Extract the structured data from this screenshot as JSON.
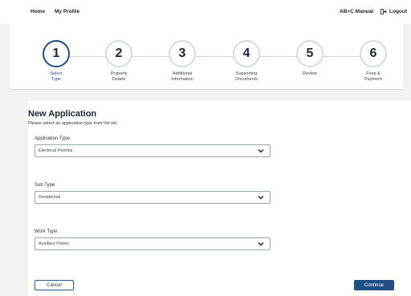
{
  "nav": {
    "home": "Home",
    "profile": "My Profile",
    "manual": "AB+C Manual",
    "logout": "Logout",
    "logout_icon": "logout-icon"
  },
  "steps": [
    {
      "number": "1",
      "line1": "Select",
      "line2": "Type",
      "active": true
    },
    {
      "number": "2",
      "line1": "Property",
      "line2": "Details",
      "active": false
    },
    {
      "number": "3",
      "line1": "Additional",
      "line2": "Information",
      "active": false
    },
    {
      "number": "4",
      "line1": "Supporting",
      "line2": "Documents",
      "active": false
    },
    {
      "number": "5",
      "line1": "Review",
      "line2": "",
      "active": false
    },
    {
      "number": "6",
      "line1": "Fees &",
      "line2": "Payment",
      "active": false
    }
  ],
  "form": {
    "title": "New Application",
    "subtitle": "Please select an application type from the list.",
    "application_type": {
      "label": "Application Type",
      "value": "Electrical Permits"
    },
    "sub_type": {
      "label": "Sub Type",
      "value": "Residential"
    },
    "work_type": {
      "label": "Work Type",
      "value": "Auxiliary Power"
    }
  },
  "buttons": {
    "cancel": "Cancel",
    "continue": "Continue"
  },
  "colors": {
    "accent": "#1e4f85",
    "background": "#f2f2f2"
  }
}
